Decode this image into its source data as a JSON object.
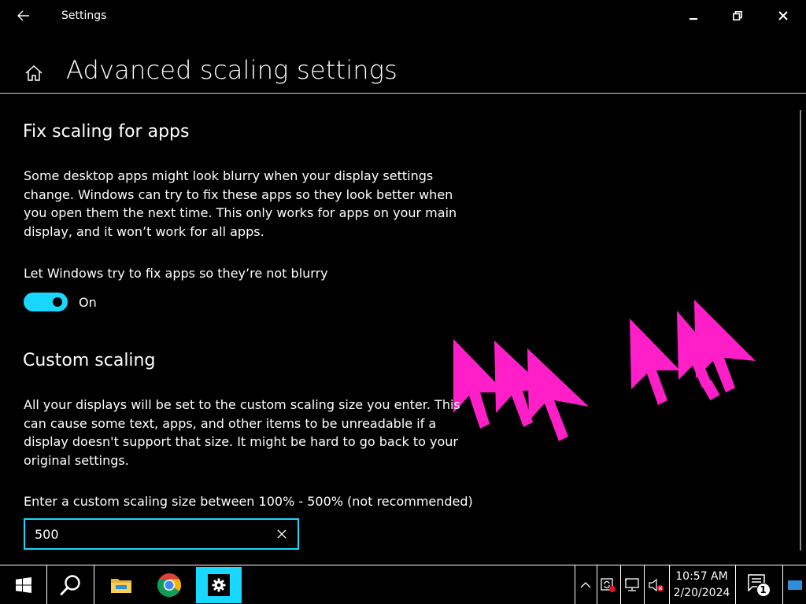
{
  "window": {
    "title": "Settings"
  },
  "header": {
    "title": "Advanced scaling settings"
  },
  "fix_scaling": {
    "heading": "Fix scaling for apps",
    "description": "Some desktop apps might look blurry when your display settings change. Windows can try to fix these apps so they look better when you open them the next time. This only works for apps on your main display, and it won’t work for all apps.",
    "toggle_label": "Let Windows try to fix apps so they’re not blurry",
    "toggle_state": "On",
    "toggle_on": true
  },
  "custom_scaling": {
    "heading": "Custom scaling",
    "description": "All your displays will be set to the custom scaling size you enter. This can cause some text, apps, and other items to be unreadable if a display doesn't support that size. It might be hard to go back to your original settings.",
    "input_label": "Enter a custom scaling size between 100% - 500% (not recommended)",
    "input_value": "500"
  },
  "taskbar": {
    "time": "10:57 AM",
    "date": "2/20/2024",
    "notification_count": "1",
    "pinned": [
      "start-icon",
      "search-icon",
      "file-explorer-icon",
      "chrome-icon",
      "settings-icon"
    ]
  },
  "colors": {
    "accent": "#19d8ff",
    "cursor_art": "#ff1fc8",
    "background": "#000000"
  }
}
